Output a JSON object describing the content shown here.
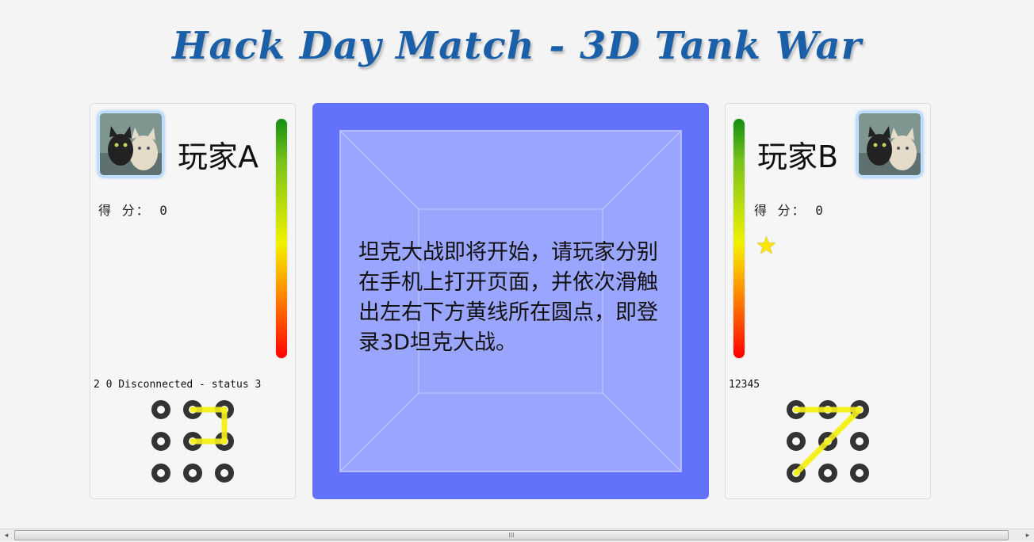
{
  "header": {
    "title": "Hack Day Match - 3D Tank War"
  },
  "player_a": {
    "name": "玩家A",
    "score_label": "得 分：",
    "score": "0",
    "status": "2 0 Disconnected - status 3",
    "avatar_icon": "cat-avatar-icon",
    "health": 1.0,
    "pattern": [
      1,
      2,
      5,
      4
    ]
  },
  "player_b": {
    "name": "玩家B",
    "score_label": "得 分：",
    "score": "0",
    "status": "12345",
    "avatar_icon": "cat-avatar-icon",
    "health": 1.0,
    "star_icon": "star-icon",
    "star": "★",
    "pattern": [
      6,
      4,
      2,
      0
    ]
  },
  "arena": {
    "message": "坦克大战即将开始，请玩家分别在手机上打开页面，并依次滑触出左右下方黄线所在圆点，即登录3D坦克大战。"
  },
  "scrollbar": {
    "left_arrow": "◂",
    "right_arrow": "▸",
    "grip": "III"
  },
  "colors": {
    "title": "#1a5fa8",
    "arena": "#6272fb",
    "arena_inner": "#9aa5fd",
    "pattern_line": "#f5f020",
    "pattern_dot": "#333333"
  }
}
